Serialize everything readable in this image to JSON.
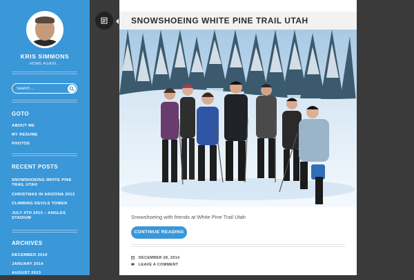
{
  "sidebar": {
    "site_title": "KRIS SIMMONS",
    "site_description": "HOME AGAIN...",
    "search_placeholder": "Search ...",
    "goto": {
      "title": "GOTO",
      "items": [
        "ABOUT ME",
        "MY RESUME",
        "PHOTOS"
      ]
    },
    "recent_posts": {
      "title": "RECENT POSTS",
      "items": [
        "SNOWSHOEING WHITE PINE TRAIL UTAH",
        "CHRISTMAS IN ARIZONA 2013",
        "CLIMBING DEVILS TOWER",
        "JULY 4TH 2013 – ANGLES STADIUM"
      ]
    },
    "archives": {
      "title": "ARCHIVES",
      "items": [
        "DECEMBER 2014",
        "JANUARY 2014",
        "AUGUST 2013"
      ]
    }
  },
  "post": {
    "title": "SNOWSHOEING WHITE PINE TRAIL UTAH",
    "caption": "Snowshoeing with friends at White Pine Trail Utah",
    "continue_label": "CONTINUE READING",
    "date": "DECEMBER 28, 2014",
    "comment_label": "LEAVE A COMMENT"
  },
  "icons": {
    "search": "search-icon",
    "post_toggle": "post-list-icon",
    "calendar": "calendar-icon",
    "comment": "comment-icon"
  },
  "colors": {
    "accent": "#3a97d8",
    "background": "#3a3a3a",
    "title_bar": "#f2f2f2"
  }
}
